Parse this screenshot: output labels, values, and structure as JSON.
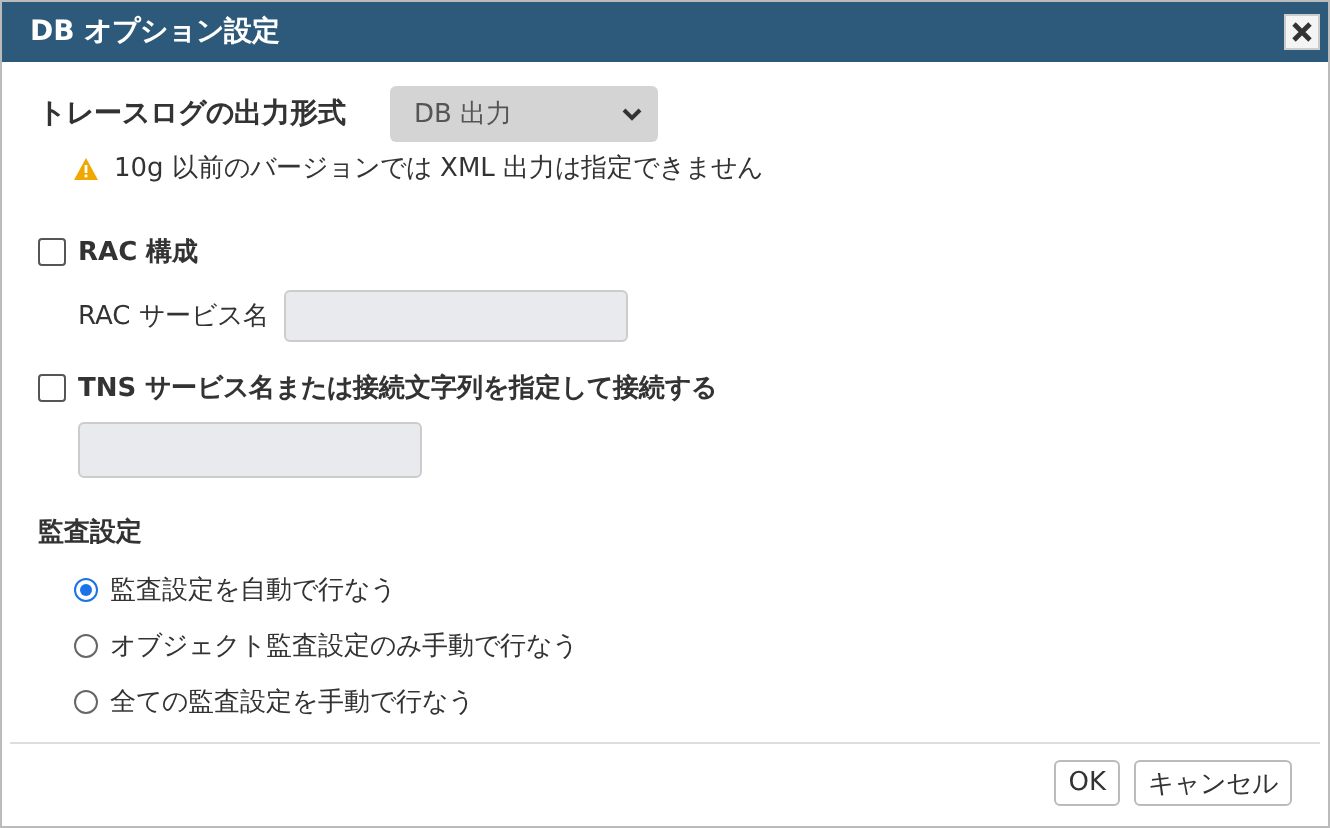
{
  "window": {
    "title": "DB オプション設定"
  },
  "trace": {
    "label": "トレースログの出力形式",
    "value": "DB 出力",
    "warning": "10g 以前のバージョンでは XML 出力は指定できません"
  },
  "rac": {
    "label": "RAC 構成",
    "checked": false,
    "field_label": "RAC サービス名"
  },
  "tns": {
    "label": "TNS サービス名または接続文字列を指定して接続する",
    "checked": false
  },
  "audit": {
    "title": "監査設定",
    "options": [
      {
        "label": "監査設定を自動で行なう",
        "selected": true
      },
      {
        "label": "オブジェクト監査設定のみ手動で行なう",
        "selected": false
      },
      {
        "label": "全ての監査設定を手動で行なう",
        "selected": false
      }
    ]
  },
  "buttons": [
    "OK",
    "キャンセル"
  ]
}
